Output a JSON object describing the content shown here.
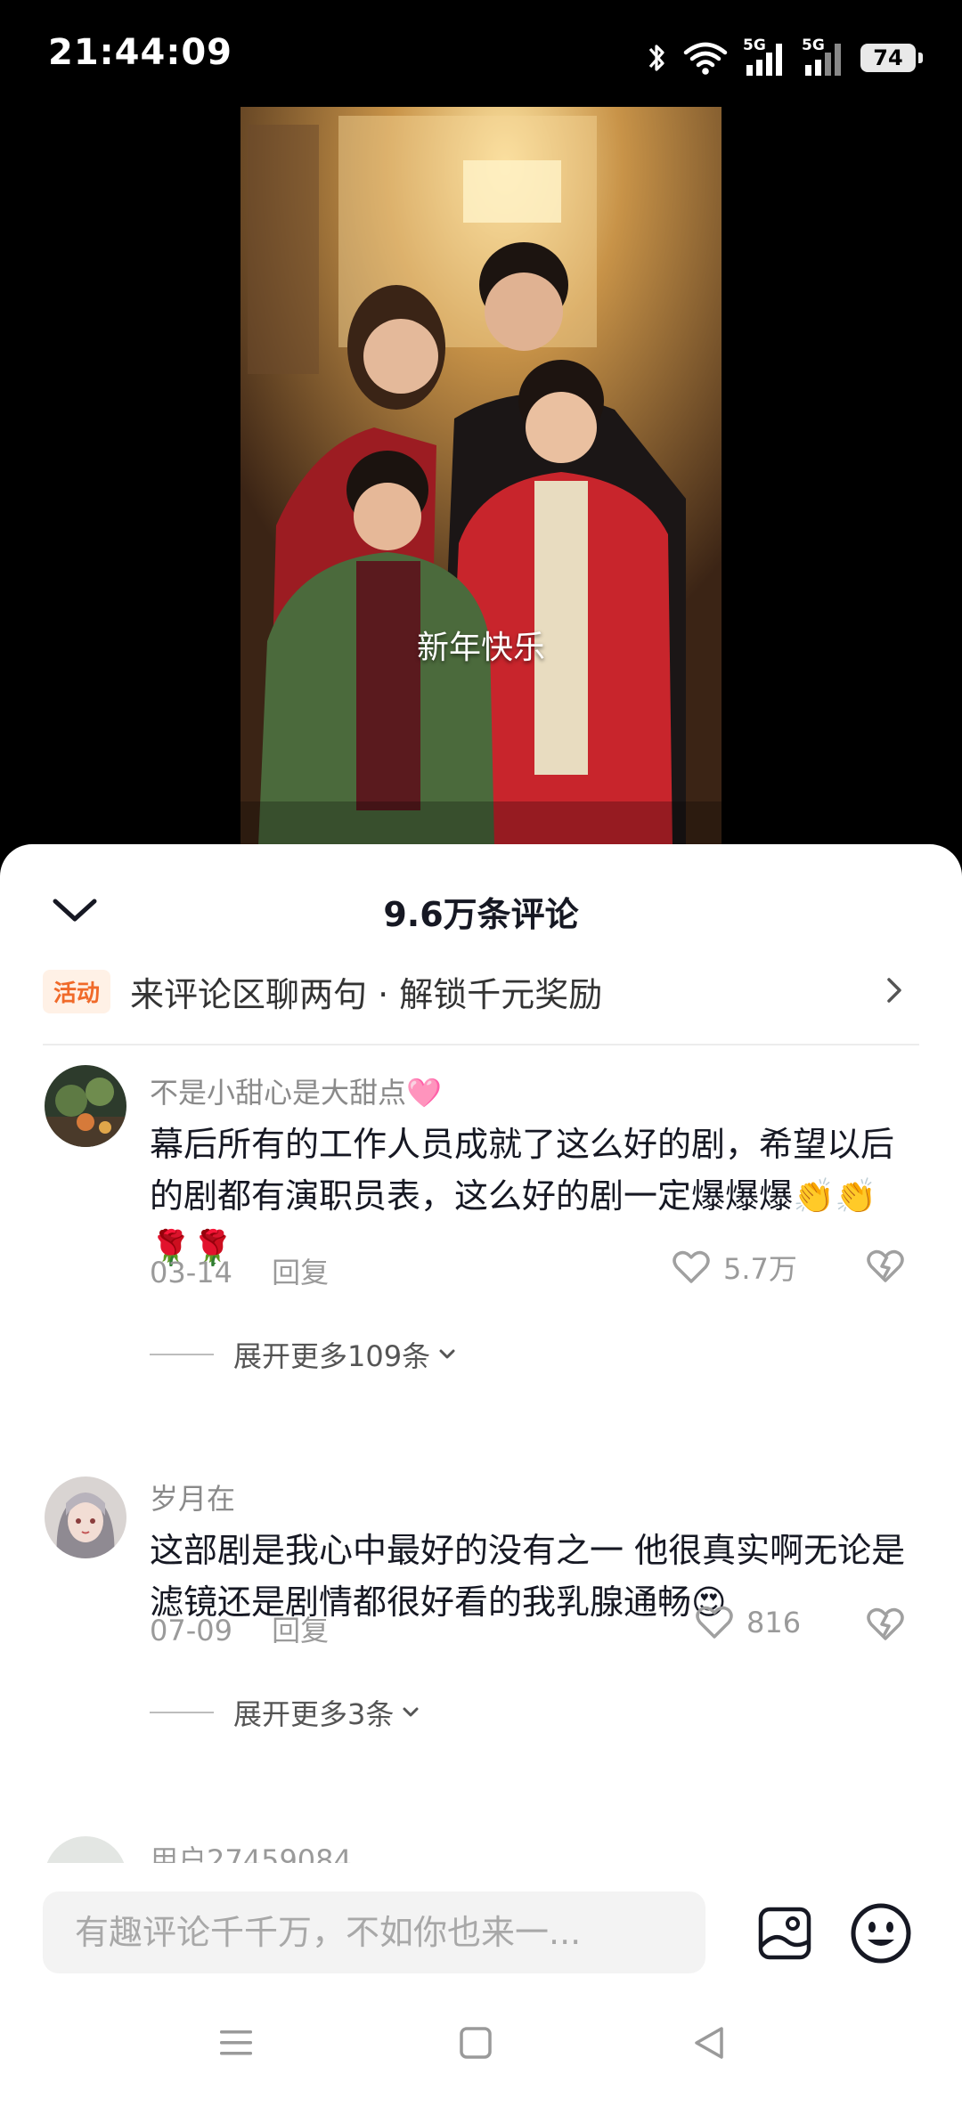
{
  "status_bar": {
    "time": "21:44:09",
    "network_1": "5G",
    "network_2": "5G",
    "battery": "74",
    "icons": [
      "bluetooth-icon",
      "wifi-icon",
      "signal-icon",
      "signal-icon",
      "battery-icon"
    ]
  },
  "video": {
    "subtitle": "新年快乐"
  },
  "comments_panel": {
    "title": "9.6万条评论",
    "promo": {
      "badge": "活动",
      "text": "来评论区聊两句 · 解锁千元奖励"
    },
    "comments": [
      {
        "username": "不是小甜心是大甜点🩷",
        "text": "幕后所有的工作人员成就了这么好的剧，希望以后的剧都有演职员表，这么好的剧一定爆爆爆👏👏🌹🌹",
        "date": "03-14",
        "reply_label": "回复",
        "likes": "5.7万",
        "expand_label": "展开更多109条"
      },
      {
        "username": "岁月在",
        "text": "这部剧是我心中最好的没有之一 他很真实啊无论是滤镜还是剧情都很好看的我乳腺通畅😍",
        "date": "07-09",
        "reply_label": "回复",
        "likes": "816",
        "expand_label": "展开更多3条"
      }
    ],
    "next_comment_username_partial": "用户27459084"
  },
  "input_bar": {
    "placeholder": "有趣评论千千万，不如你也来一..."
  },
  "colors": {
    "accent_orange": "#f06a2a",
    "sheet_bg": "#ffffff",
    "text_primary": "#161823",
    "text_secondary": "#9a9a9a"
  }
}
